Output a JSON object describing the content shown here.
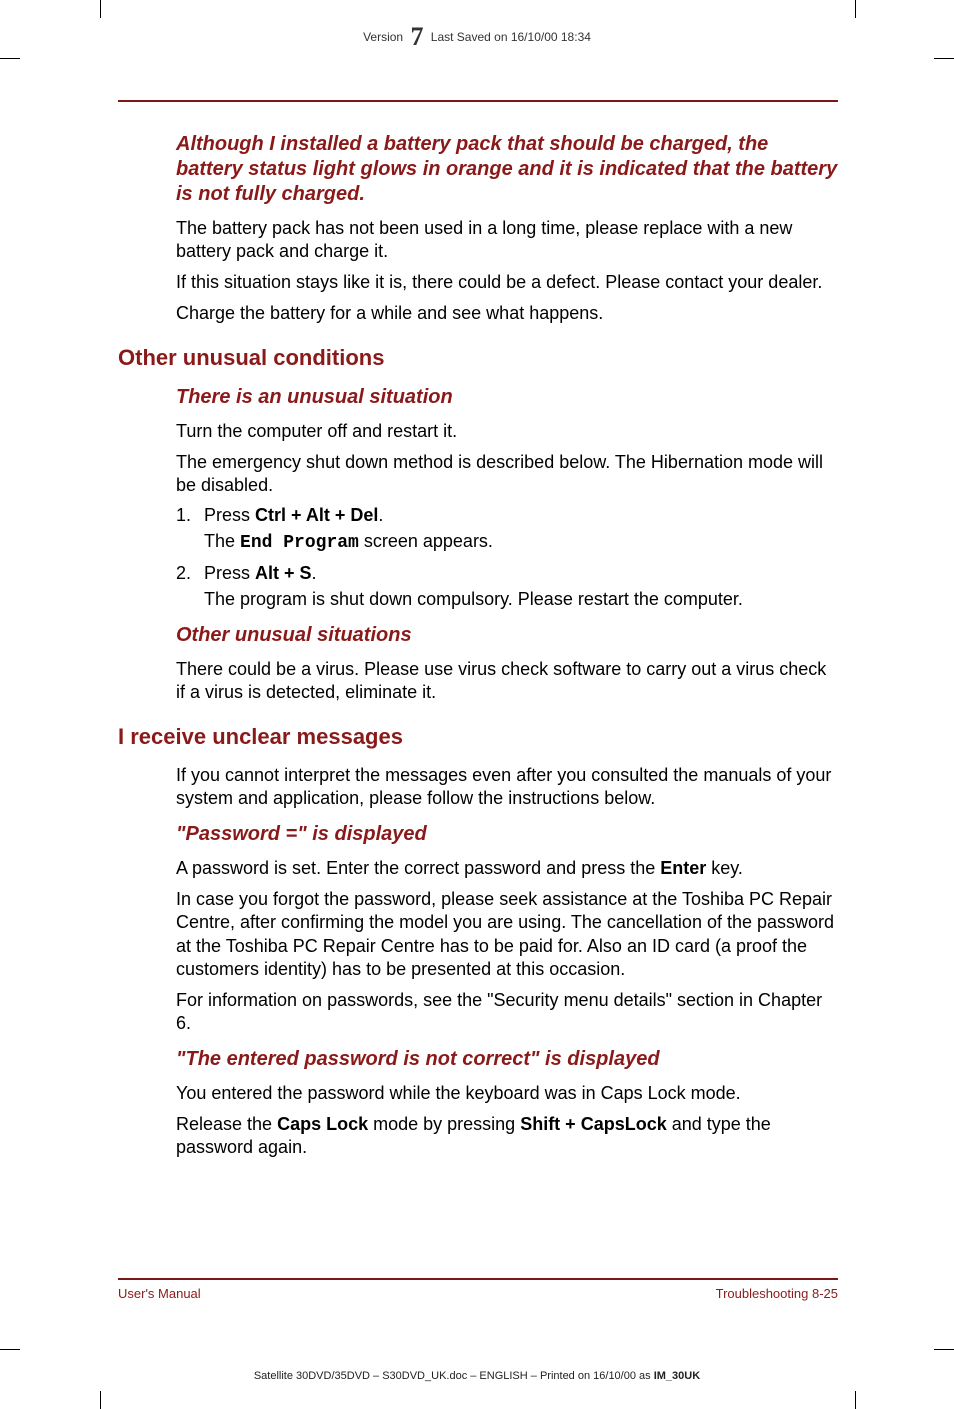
{
  "header": {
    "version_label": "Version",
    "version_number": "7",
    "saved_label": "Last Saved on 16/10/00 18:34"
  },
  "sections": {
    "battery": {
      "title": "Although I installed a battery pack that should be charged, the battery status light glows in orange and it is indicated that the battery is not fully charged.",
      "p1": "The battery pack has not been used in a long time, please replace with a new battery pack and charge it.",
      "p2": "If this situation stays like it is, there could be a defect. Please contact your dealer.",
      "p3": "Charge the battery for a while and see what happens."
    },
    "unusual_header": "Other unusual conditions",
    "unusual1": {
      "title": "There is an unusual situation",
      "p1": "Turn the computer off and restart it.",
      "p2": "The emergency shut down method is described below. The Hibernation mode will be disabled.",
      "step1_num": "1.",
      "step1_pre": "Press ",
      "step1_keys": "Ctrl + Alt + Del",
      "step1_post": ".",
      "step1_sub_pre": "The ",
      "step1_sub_mono": "End Program",
      "step1_sub_post": " screen appears.",
      "step2_num": "2.",
      "step2_pre": "Press ",
      "step2_keys": "Alt + S",
      "step2_post": ".",
      "step2_sub": "The program is shut down compulsory. Please restart the computer."
    },
    "unusual2": {
      "title": "Other unusual situations",
      "p1": "There could be a virus. Please use virus check software to carry out a virus check if a virus is detected, eliminate it."
    },
    "messages_header": "I receive unclear messages",
    "messages_intro": "If you cannot interpret the messages even after you consulted the manuals of your system and application, please follow the instructions below.",
    "password": {
      "title": "\"Password =\" is displayed",
      "p1_pre": "A password is set. Enter the correct password and press the ",
      "p1_bold": "Enter",
      "p1_post": " key.",
      "p2": "In case you forgot the password, please seek assistance at the Toshiba PC Repair Centre, after confirming the model you are using. The cancellation of the password at the Toshiba PC Repair Centre has to be paid for. Also an ID card (a proof the customers identity) has to be presented at this occasion.",
      "p3": "For information on passwords, see the \"Security menu details\" section in Chapter 6."
    },
    "wrongpw": {
      "title": "\"The entered password is not correct\" is displayed",
      "p1": "You entered the password while the keyboard was in Caps Lock mode.",
      "p2_pre": "Release the ",
      "p2_b1": "Caps Lock",
      "p2_mid": " mode by pressing ",
      "p2_b2": "Shift + CapsLock",
      "p2_post": " and type the password again."
    }
  },
  "footer": {
    "left": "User's Manual",
    "right": "Troubleshooting  8-25"
  },
  "bottom_meta": {
    "pre": "Satellite 30DVD/35DVD  – S30DVD_UK.doc – ENGLISH – Printed on 16/10/00 as ",
    "bold": "IM_30UK"
  }
}
